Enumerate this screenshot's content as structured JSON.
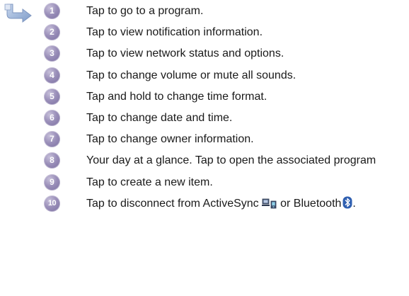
{
  "items": [
    {
      "number": "1",
      "text": "Tap to go to a program."
    },
    {
      "number": "2",
      "text": "Tap to view notification information."
    },
    {
      "number": "3",
      "text": "Tap to view network status and options."
    },
    {
      "number": "4",
      "text": "Tap to change volume or mute all sounds."
    },
    {
      "number": "5",
      "text": "Tap and hold to change time format."
    },
    {
      "number": "6",
      "text": "Tap to change date and time."
    },
    {
      "number": "7",
      "text": "Tap to change owner information."
    },
    {
      "number": "8",
      "text": "Your day at a glance. Tap to open the associated program"
    },
    {
      "number": "9",
      "text": "Tap to create a new item."
    },
    {
      "number": "10",
      "text_before": "Tap to disconnect from ActiveSync",
      "text_middle": "or Bluetooth",
      "text_after": "."
    }
  ],
  "icons": {
    "pointer": "pointer-arrow-icon",
    "activesync": "activesync-icon",
    "bluetooth": "bluetooth-icon"
  },
  "colors": {
    "badge": "#8e84b0",
    "text": "#1a1a1a"
  }
}
